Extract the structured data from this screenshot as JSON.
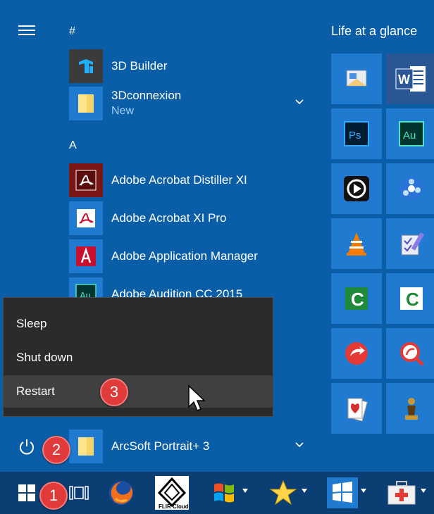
{
  "start_menu": {
    "nav": {
      "menu_icon": "hamburger-icon",
      "power_icon": "power-icon"
    },
    "groups": [
      {
        "header": "#",
        "apps": [
          {
            "label": "3D Builder",
            "icon": "3d-builder-icon",
            "badge": "",
            "expandable": false
          },
          {
            "label": "3Dconnexion",
            "icon": "folder-icon",
            "badge": "New",
            "expandable": true
          }
        ]
      },
      {
        "header": "A",
        "apps": [
          {
            "label": "Adobe Acrobat Distiller XI",
            "icon": "acrobat-distiller-icon",
            "badge": "",
            "expandable": false
          },
          {
            "label": "Adobe Acrobat XI Pro",
            "icon": "acrobat-pro-icon",
            "badge": "",
            "expandable": false
          },
          {
            "label": "Adobe Application Manager",
            "icon": "adobe-app-manager-icon",
            "badge": "",
            "expandable": false
          },
          {
            "label": "Adobe Audition CC 2015",
            "icon": "audition-icon",
            "badge": "",
            "expandable": false
          },
          {
            "label": "ArcSoft Portrait+ 3",
            "icon": "folder-icon",
            "badge": "",
            "expandable": true
          }
        ]
      }
    ],
    "tiles_header": "Life at a glance",
    "tiles": [
      {
        "icon": "outlook-icon",
        "label": ""
      },
      {
        "icon": "word-icon",
        "label": "W"
      },
      {
        "icon": "photoshop-icon",
        "label": "Ps"
      },
      {
        "icon": "audition-tile-icon",
        "label": "Au"
      },
      {
        "icon": "media-player-icon",
        "label": ""
      },
      {
        "icon": "reel-icon",
        "label": ""
      },
      {
        "icon": "vlc-icon",
        "label": ""
      },
      {
        "icon": "checklist-icon",
        "label": ""
      },
      {
        "icon": "camtasia-icon",
        "label": "C"
      },
      {
        "icon": "camtasia-recorder-icon",
        "label": "C"
      },
      {
        "icon": "red-arrow-icon",
        "label": ""
      },
      {
        "icon": "magnifier-icon",
        "label": ""
      },
      {
        "icon": "solitaire-icon",
        "label": ""
      },
      {
        "icon": "chess-icon",
        "label": ""
      }
    ]
  },
  "power_menu": {
    "items": [
      {
        "label": "Sleep"
      },
      {
        "label": "Shut down"
      },
      {
        "label": "Restart"
      }
    ]
  },
  "annotations": {
    "steps": [
      "1",
      "2",
      "3"
    ]
  },
  "taskbar": {
    "items": [
      {
        "icon": "windows-start-icon"
      },
      {
        "icon": "task-view-icon"
      },
      {
        "icon": "firefox-icon"
      },
      {
        "icon": "flir-cloud-icon",
        "label": "FLIR Cloud"
      },
      {
        "icon": "windows-xp-flag-icon"
      },
      {
        "icon": "star-icon"
      },
      {
        "icon": "windows-flag-icon"
      },
      {
        "icon": "first-aid-kit-icon"
      }
    ]
  },
  "colors": {
    "start_bg": "#0a5ea8",
    "taskbar_bg": "#0b3e73",
    "tile_blue": "#1f7ad0",
    "power_menu_bg": "#2b2b2b",
    "step_badge": "#e03a3a"
  }
}
